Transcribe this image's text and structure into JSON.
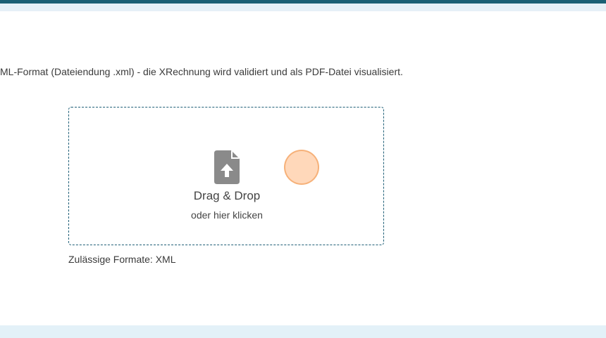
{
  "intro": {
    "text": "ML-Format (Dateiendung .xml) - die XRechnung wird validiert und als PDF-Datei visualisiert."
  },
  "dropzone": {
    "icon": "file-upload-icon",
    "title": "Drag & Drop",
    "subtitle": "oder hier klicken"
  },
  "formats": {
    "text": "Zulässige Formate: XML"
  },
  "colors": {
    "header_dark": "#1b5f74",
    "header_light": "#e6f0f7",
    "dropzone_border": "#1f5f77",
    "icon_gray": "#8a8a8a",
    "cursor_highlight": "#ffd3b0",
    "footer_band": "#e3f1f8"
  }
}
